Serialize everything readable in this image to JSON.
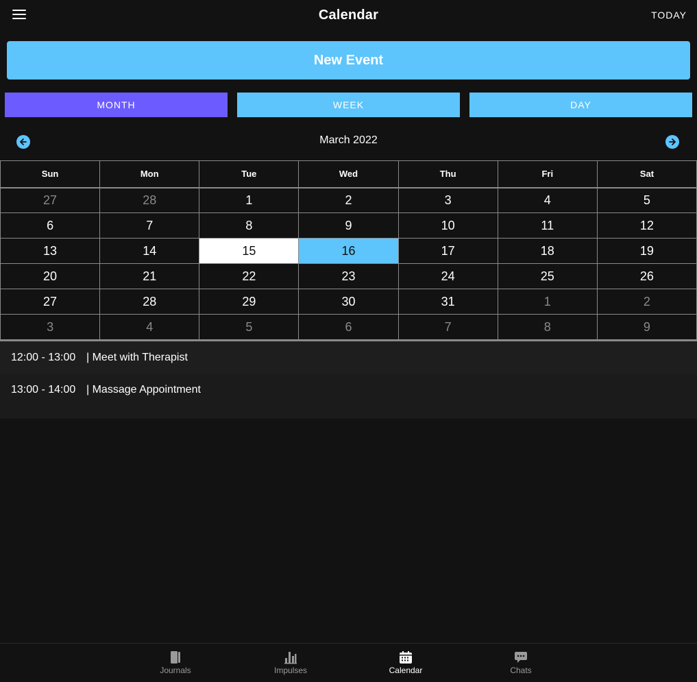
{
  "header": {
    "title": "Calendar",
    "today_label": "TODAY"
  },
  "actions": {
    "new_event_label": "New Event"
  },
  "view_tabs": [
    {
      "label": "MONTH",
      "active": true
    },
    {
      "label": "WEEK",
      "active": false
    },
    {
      "label": "DAY",
      "active": false
    }
  ],
  "month_nav": {
    "label": "March 2022"
  },
  "calendar": {
    "weekdays": [
      "Sun",
      "Mon",
      "Tue",
      "Wed",
      "Thu",
      "Fri",
      "Sat"
    ],
    "weeks": [
      [
        "27",
        "28",
        "1",
        "2",
        "3",
        "4",
        "5"
      ],
      [
        "6",
        "7",
        "8",
        "9",
        "10",
        "11",
        "12"
      ],
      [
        "13",
        "14",
        "15",
        "16",
        "17",
        "18",
        "19"
      ],
      [
        "20",
        "21",
        "22",
        "23",
        "24",
        "25",
        "26"
      ],
      [
        "27",
        "28",
        "29",
        "30",
        "31",
        "1",
        "2"
      ],
      [
        "3",
        "4",
        "5",
        "6",
        "7",
        "8",
        "9"
      ]
    ],
    "today": "15",
    "selected": "16"
  },
  "events": [
    {
      "time": "12:00 - 13:00",
      "title": "| Meet with Therapist"
    },
    {
      "time": "13:00 - 14:00",
      "title": "| Massage Appointment"
    }
  ],
  "bottom_nav": [
    {
      "label": "Journals",
      "icon": "journal-icon",
      "active": false
    },
    {
      "label": "Impulses",
      "icon": "bar-chart-icon",
      "active": false
    },
    {
      "label": "Calendar",
      "icon": "calendar-icon",
      "active": true
    },
    {
      "label": "Chats",
      "icon": "chat-bubble-icon",
      "active": false
    }
  ],
  "colors": {
    "background": "#121212",
    "accent_blue": "#5ec4fc",
    "accent_purple": "#6c5cff"
  }
}
